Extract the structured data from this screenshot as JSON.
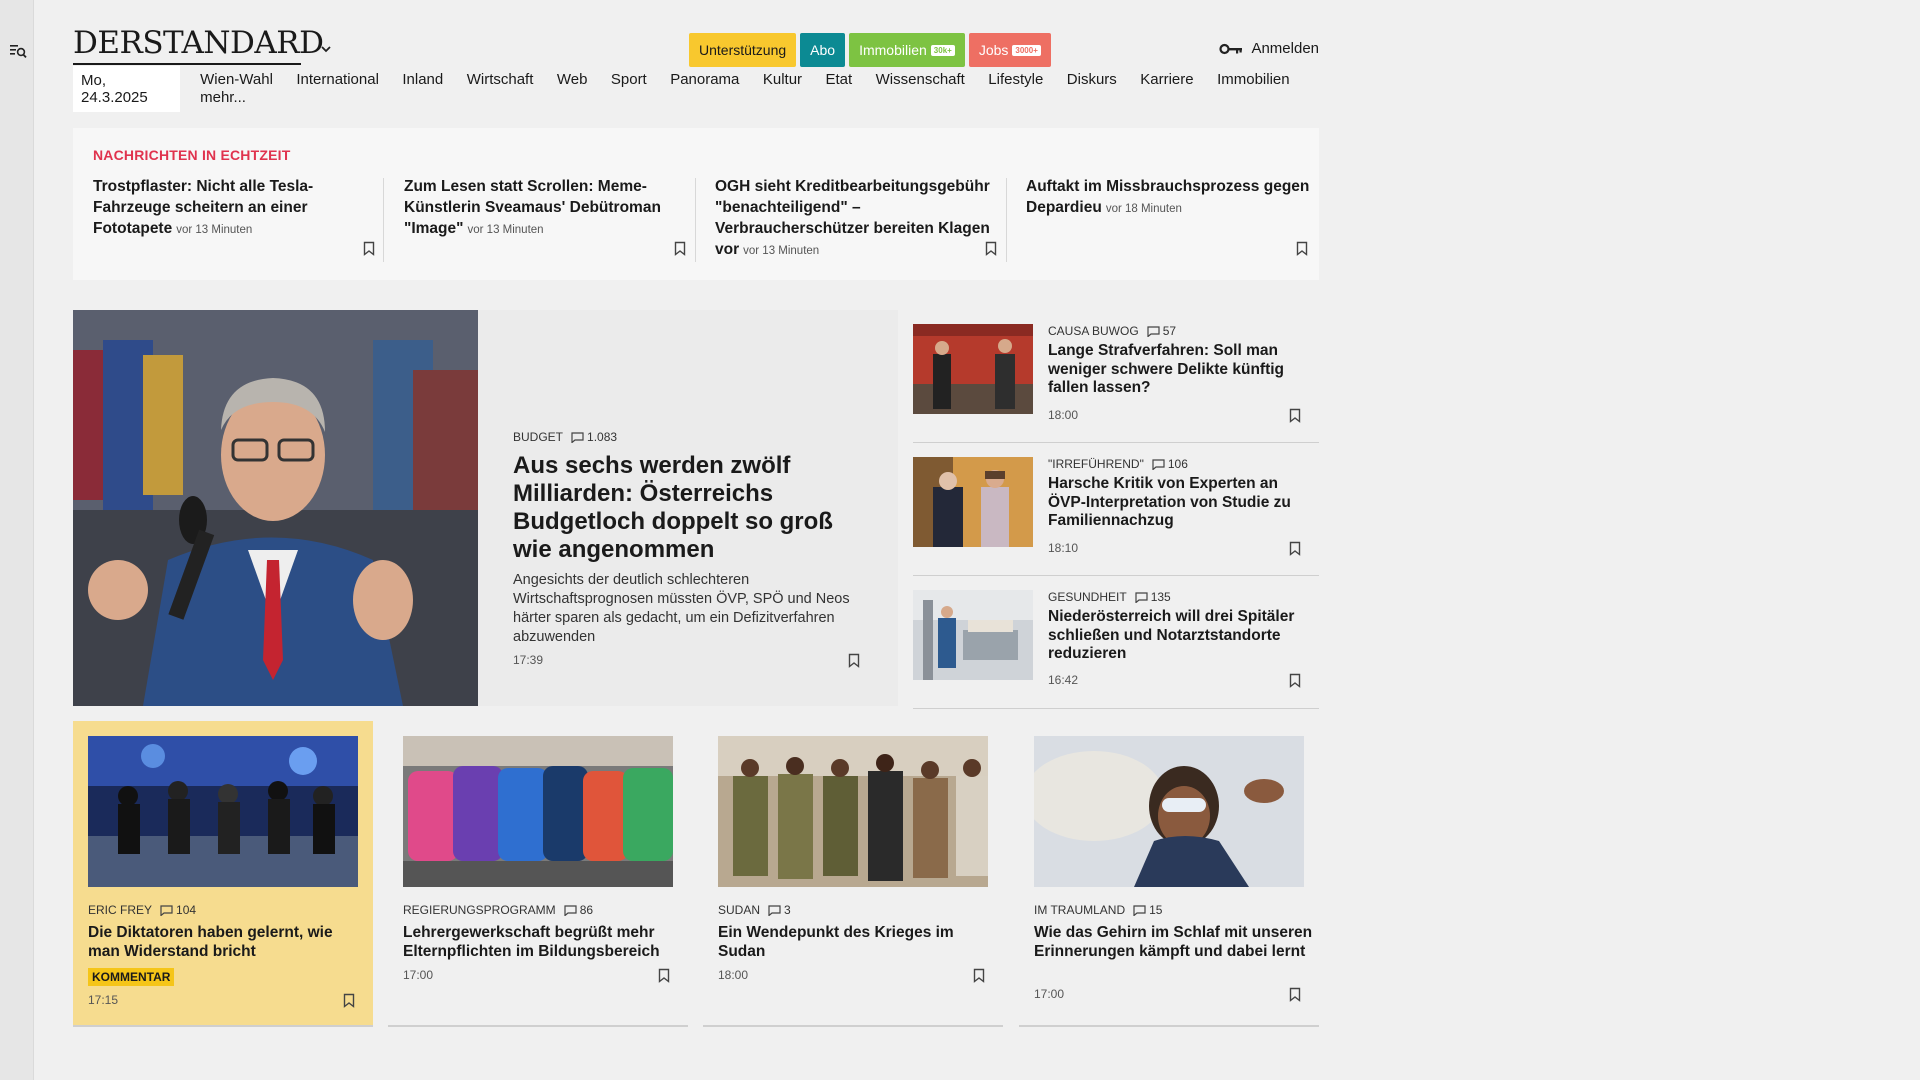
{
  "brand": {
    "logo": "DERSTANDARD"
  },
  "header": {
    "pills": [
      {
        "label": "Unterstützung",
        "mini": ""
      },
      {
        "label": "Abo",
        "mini": ""
      },
      {
        "label": "Immobilien",
        "mini": "30k+"
      },
      {
        "label": "Jobs",
        "mini": "3000+"
      }
    ],
    "login": "Anmelden"
  },
  "nav": {
    "date": "Mo, 24.3.2025",
    "items": [
      "Wien-Wahl",
      "International",
      "Inland",
      "Wirtschaft",
      "Web",
      "Sport",
      "Panorama",
      "Kultur",
      "Etat",
      "Wissenschaft",
      "Lifestyle",
      "Diskurs",
      "Karriere",
      "Immobilien",
      "mehr..."
    ]
  },
  "live": {
    "heading": "NACHRICHTEN IN ECHTZEIT",
    "items": [
      {
        "title": "Trostpflaster: Nicht alle Tesla-Fahrzeuge scheitern an einer Fototapete",
        "ago": "vor 13 Minuten"
      },
      {
        "title": "Zum Lesen statt Scrollen: Meme-Künstlerin Sveamaus' Debütroman \"Image\"",
        "ago": "vor 13 Minuten"
      },
      {
        "title": "OGH sieht Kreditbearbeitungsgebühr \"benachteiligend\" – Verbraucherschützer bereiten Klagen vor",
        "ago": "vor 13 Minuten"
      },
      {
        "title": "Auftakt im Missbrauchsprozess gegen Depardieu",
        "ago": "vor 18 Minuten"
      }
    ]
  },
  "lead": {
    "kicker": "BUDGET",
    "comments": "1.083",
    "title": "Aus sechs werden zwölf Milliarden: Österreichs Budgetloch doppelt so groß wie angenommen",
    "teaser": "Angesichts der deutlich schlechteren Wirtschaftsprognosen müssten ÖVP, SPÖ und Neos härter sparen als gedacht, um ein Defizitverfahren abzuwenden",
    "time": "17:39"
  },
  "side": [
    {
      "kicker": "CAUSA BUWOG",
      "comments": "57",
      "title": "Lange Strafverfahren: Soll man weniger schwere Delikte künftig fallen lassen?",
      "time": "18:00"
    },
    {
      "kicker": "\"IRREFÜHREND\"",
      "comments": "106",
      "title": "Harsche Kritik von Experten an ÖVP-Interpretation von Studie zu Familiennachzug",
      "time": "18:10"
    },
    {
      "kicker": "GESUNDHEIT",
      "comments": "135",
      "title": "Niederösterreich will drei Spitäler schließen und Notarztstandorte reduzieren",
      "time": "16:42"
    }
  ],
  "cards": [
    {
      "kicker": "ERIC FREY",
      "comments": "104",
      "title": "Die Diktatoren haben gelernt, wie man Widerstand bricht",
      "badge": "KOMMENTAR",
      "time": "17:15"
    },
    {
      "kicker": "REGIERUNGSPROGRAMM",
      "comments": "86",
      "title": "Lehrergewerkschaft begrüßt mehr Elternpflichten im Bildungsbereich",
      "badge": "",
      "time": "17:00"
    },
    {
      "kicker": "SUDAN",
      "comments": "3",
      "title": "Ein Wendepunkt des Krieges im Sudan",
      "badge": "",
      "time": "18:00"
    },
    {
      "kicker": "IM TRAUMLAND",
      "comments": "15",
      "title": "Wie das Gehirn im Schlaf mit unseren Erinnerungen kämpft und dabei lernt",
      "badge": "",
      "time": "17:00"
    }
  ],
  "colors": {
    "accent_live": "#e0334e",
    "support": "#f8c82e",
    "abo": "#0c8a93",
    "immo": "#7dc342",
    "jobs": "#ee6f63",
    "highlight_card": "#f6dc8f"
  }
}
